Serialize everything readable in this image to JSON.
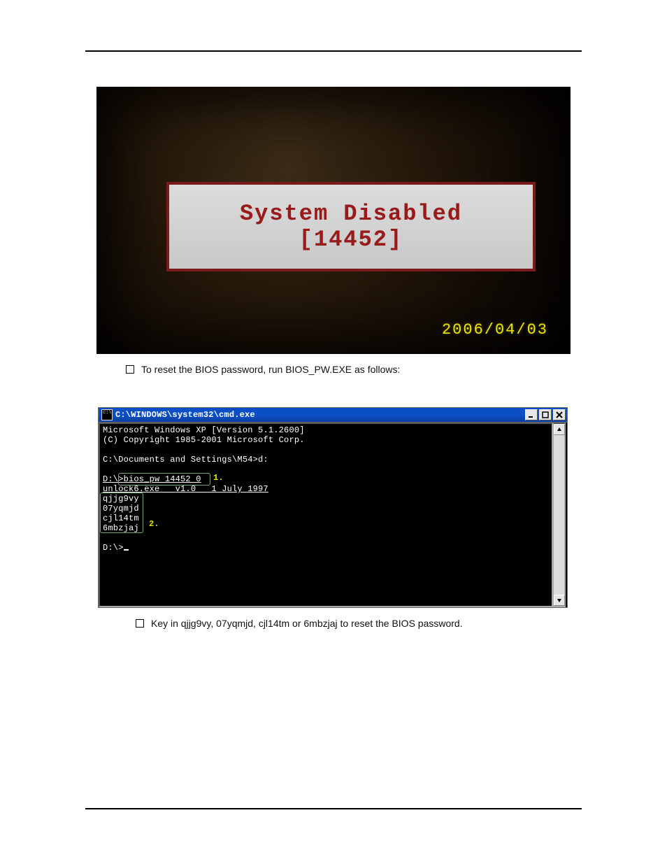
{
  "header": {
    "left": "",
    "right": ""
  },
  "photo1": {
    "line1": "System Disabled",
    "line2": "[14452]",
    "date": "2006/04/03"
  },
  "bullet1": {
    "text_prefix": "To reset the BIOS password, run BIOS_PW.EXE as follows:"
  },
  "cmd": {
    "title": "C:\\WINDOWS\\system32\\cmd.exe",
    "lines": [
      "Microsoft Windows XP [Version 5.1.2600]",
      "(C) Copyright 1985-2001 Microsoft Corp.",
      "",
      "C:\\Documents and Settings\\M54>d:",
      "",
      "D:\\>bios_pw 14452 0",
      "unlock6.exe   v1.0   1 July 1997",
      "qjjg9vy",
      "07yqmjd",
      "cjl14tm",
      "6mbzjaj",
      "",
      "D:\\>_"
    ],
    "anno1": "1.",
    "anno2": "2."
  },
  "bullet2": {
    "text": "Key in qjjg9vy, 07yqmjd, cjl14tm or 6mbzjaj to reset the BIOS password."
  },
  "footer": {
    "left": "",
    "right": ""
  }
}
